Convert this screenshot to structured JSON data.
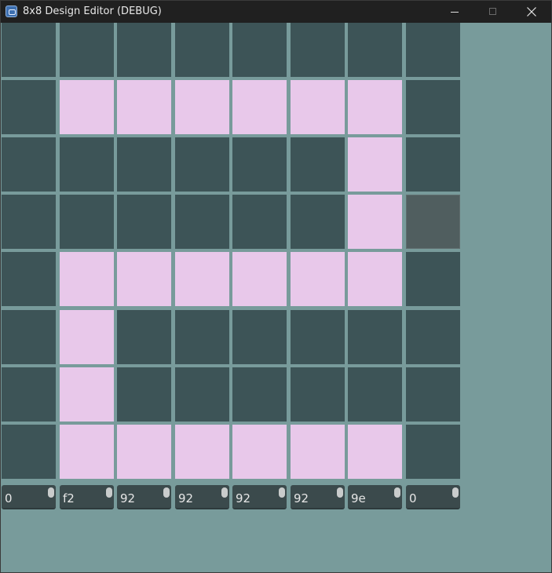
{
  "window": {
    "title": "8x8 Design Editor (DEBUG)",
    "icons": {
      "app": "app-icon",
      "minimize": "minimize-icon",
      "maximize": "maximize-icon",
      "close": "close-icon"
    }
  },
  "colors": {
    "background": "#789b9b",
    "cell_off": "#3d5457",
    "cell_on": "#e8c8ea",
    "cell_hover": "#505e5f",
    "spinbox": "#3b4a4c"
  },
  "grid": {
    "columns": 8,
    "rows": 8,
    "hovered_cell": {
      "row": 3,
      "col": 7
    },
    "cells": [
      [
        0,
        0,
        0,
        0,
        0,
        0,
        0,
        0
      ],
      [
        0,
        1,
        1,
        1,
        1,
        1,
        1,
        0
      ],
      [
        0,
        0,
        0,
        0,
        0,
        0,
        1,
        0
      ],
      [
        0,
        0,
        0,
        0,
        0,
        0,
        1,
        0
      ],
      [
        0,
        1,
        1,
        1,
        1,
        1,
        1,
        0
      ],
      [
        0,
        1,
        0,
        0,
        0,
        0,
        0,
        0
      ],
      [
        0,
        1,
        0,
        0,
        0,
        0,
        0,
        0
      ],
      [
        0,
        1,
        1,
        1,
        1,
        1,
        1,
        0
      ]
    ]
  },
  "column_values": [
    "0",
    "f2",
    "92",
    "92",
    "92",
    "92",
    "9e",
    "0"
  ]
}
